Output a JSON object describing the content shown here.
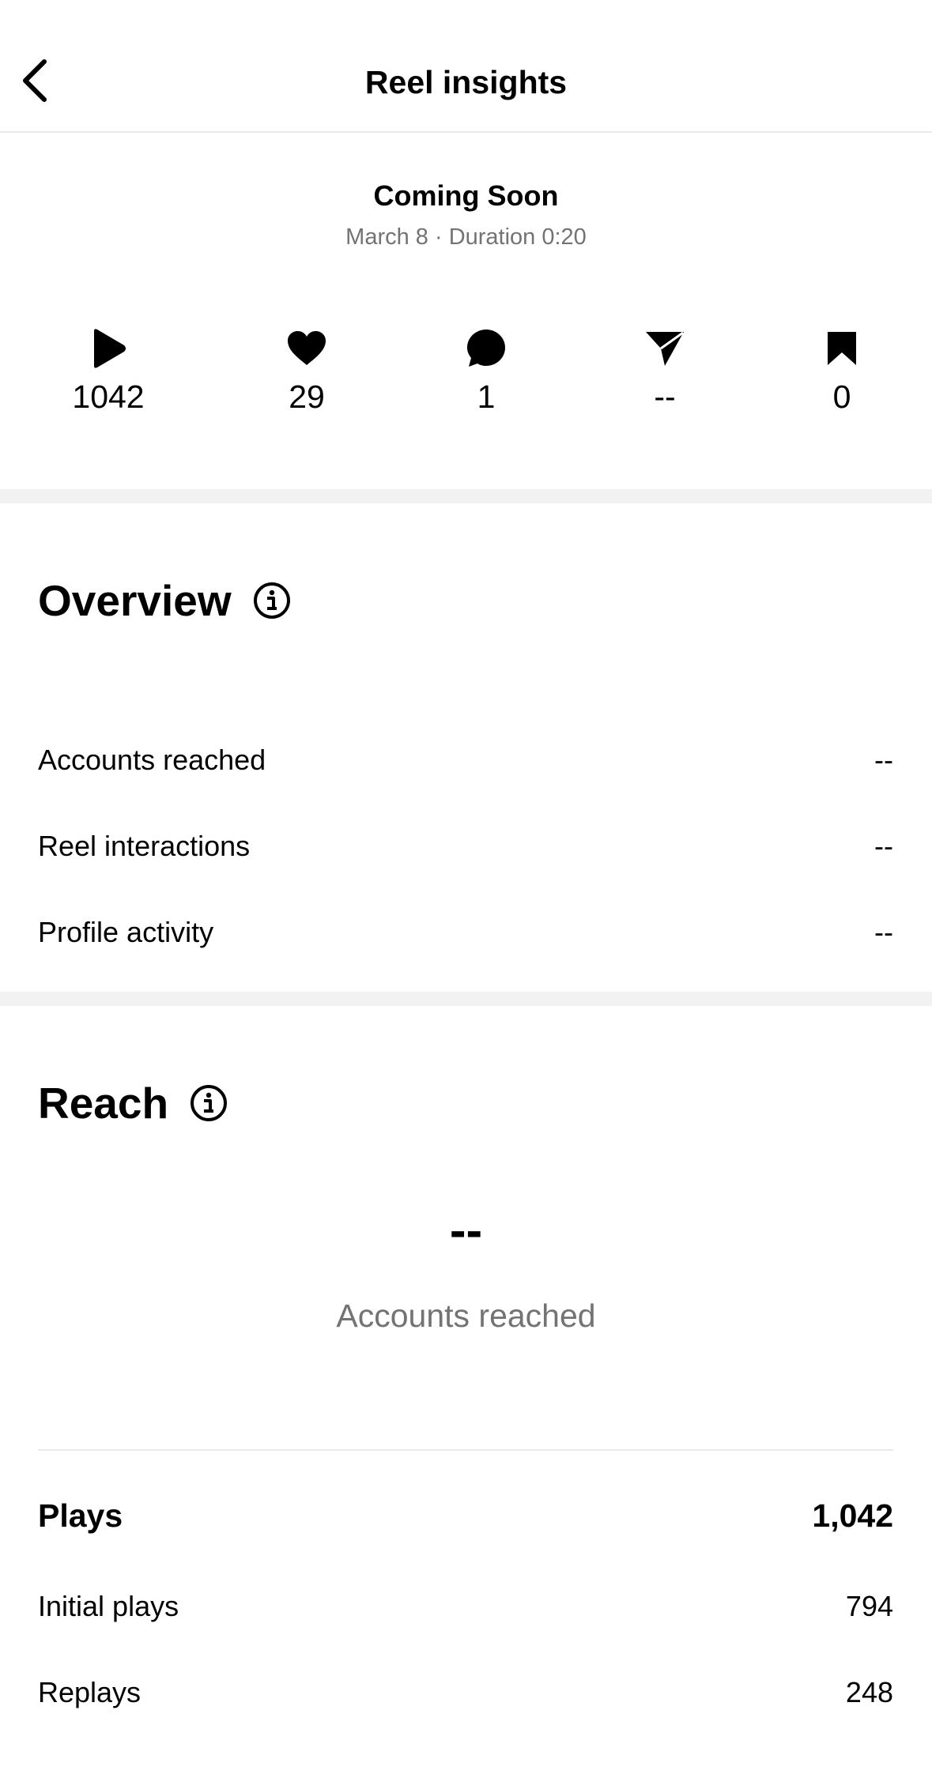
{
  "header": {
    "title": "Reel insights",
    "back_icon": "chevron-left-icon"
  },
  "reel": {
    "title": "Coming Soon",
    "meta": "March 8 · Duration 0:20"
  },
  "stats": [
    {
      "icon": "play-icon",
      "value": "1042"
    },
    {
      "icon": "heart-icon",
      "value": "29"
    },
    {
      "icon": "comment-icon",
      "value": "1"
    },
    {
      "icon": "share-icon",
      "value": "--"
    },
    {
      "icon": "bookmark-icon",
      "value": "0"
    }
  ],
  "overview": {
    "title": "Overview",
    "rows": [
      {
        "label": "Accounts reached",
        "value": "--"
      },
      {
        "label": "Reel interactions",
        "value": "--"
      },
      {
        "label": "Profile activity",
        "value": "--"
      }
    ]
  },
  "reach": {
    "title": "Reach",
    "value": "--",
    "label": "Accounts reached"
  },
  "plays": {
    "label": "Plays",
    "value": "1,042",
    "rows": [
      {
        "label": "Initial plays",
        "value": "794"
      },
      {
        "label": "Replays",
        "value": "248"
      }
    ]
  },
  "colors": {
    "text": "#000000",
    "secondary": "#737373",
    "divider": "#f2f2f2"
  }
}
